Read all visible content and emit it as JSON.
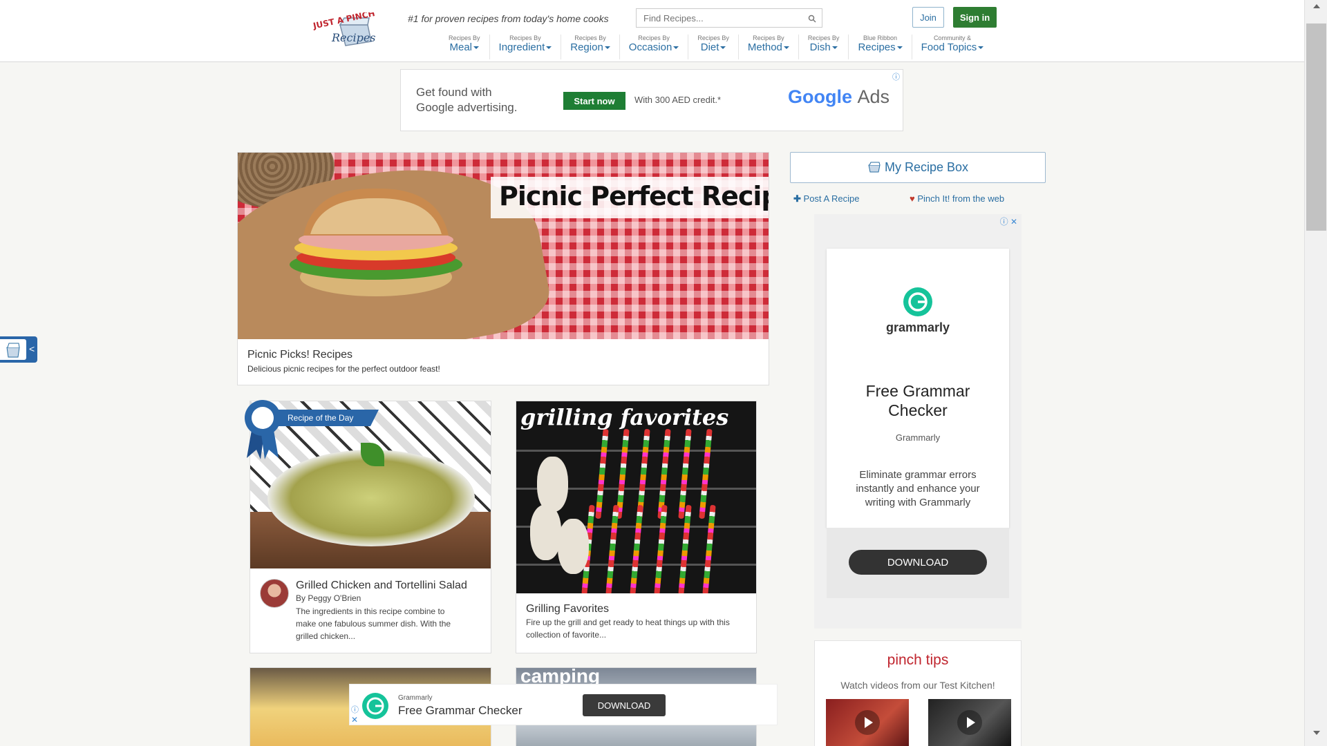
{
  "header": {
    "tagline": "#1 for proven recipes from today's home cooks",
    "search_placeholder": "Find Recipes...",
    "join_label": "Join",
    "signin_label": "Sign in",
    "logo_text_top": "JUST A PINCH",
    "logo_text_bottom": "Recipes"
  },
  "nav": [
    {
      "small": "Recipes By",
      "label": "Meal"
    },
    {
      "small": "Recipes By",
      "label": "Ingredient"
    },
    {
      "small": "Recipes By",
      "label": "Region"
    },
    {
      "small": "Recipes By",
      "label": "Occasion"
    },
    {
      "small": "Recipes By",
      "label": "Diet"
    },
    {
      "small": "Recipes By",
      "label": "Method"
    },
    {
      "small": "Recipes By",
      "label": "Dish"
    },
    {
      "small": "Blue Ribbon",
      "label": "Recipes"
    },
    {
      "small": "Community &",
      "label": "Food Topics"
    }
  ],
  "top_ad": {
    "line1": "Get found with",
    "line2": "Google advertising.",
    "button": "Start now",
    "credit": "With 300 AED credit.*",
    "logo_google": "Google",
    "logo_ads": "Ads"
  },
  "hero": {
    "title": "Picnic Perfect Recipes",
    "caption": "Picnic Picks! Recipes",
    "subtitle": "Delicious picnic recipes for the perfect outdoor feast!"
  },
  "cards": [
    {
      "badge": "Recipe of the Day",
      "title": "Grilled Chicken and Tortellini Salad",
      "author": "By Peggy O'Brien",
      "desc_line1": "The ingredients in this recipe combine to",
      "desc_line2": "make one fabulous summer dish. With the",
      "desc_line3": "grilled chicken..."
    },
    {
      "image_title": "grilling favorites",
      "title": "Grilling Favorites",
      "desc_line1": "Fire up the grill and get ready to heat things up with this",
      "desc_line2": "collection of favorite..."
    },
    {
      "image_title": "camping"
    }
  ],
  "bottom_ad": {
    "brand": "Grammarly",
    "headline": "Free Grammar Checker",
    "button": "DOWNLOAD"
  },
  "sidebar": {
    "recipe_box": "My Recipe Box",
    "post_recipe": "Post A Recipe",
    "pinch_it": "Pinch It! from the web"
  },
  "side_ad": {
    "logo": "grammarly",
    "headline_line1": "Free Grammar",
    "headline_line2": "Checker",
    "brand": "Grammarly",
    "body": "Eliminate grammar errors instantly and enhance your writing with Grammarly",
    "button": "DOWNLOAD"
  },
  "tips": {
    "title": "pinch tips",
    "subtitle": "Watch videos from our Test Kitchen!"
  },
  "colors": {
    "brand_blue": "#2a6ea2",
    "signin_green": "#2e7d32",
    "tips_red": "#c0252e",
    "grammarly_green": "#15c39a"
  }
}
